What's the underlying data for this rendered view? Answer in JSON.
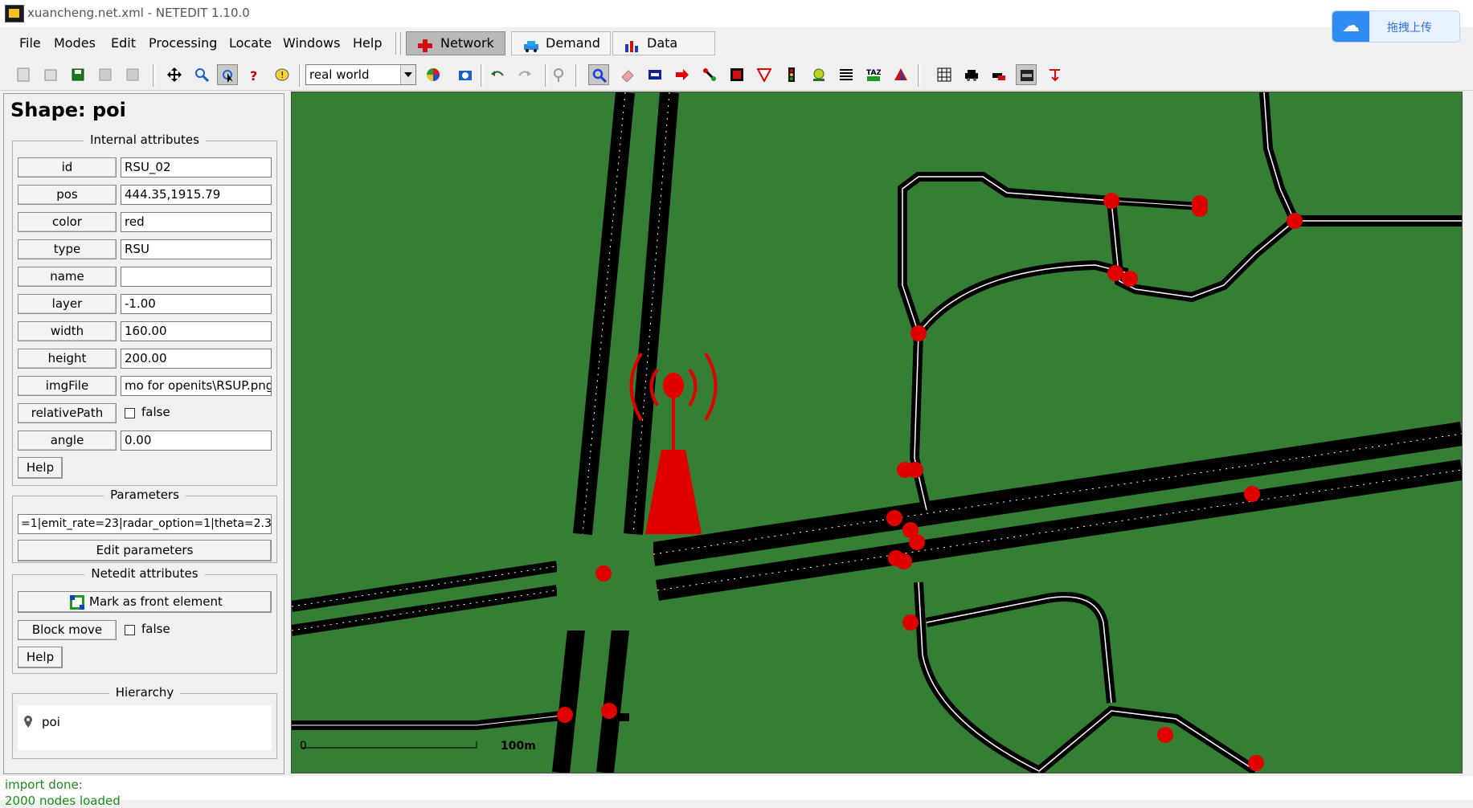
{
  "window": {
    "title": "xuancheng.net.xml - NETEDIT 1.10.0"
  },
  "upload_button": {
    "label": "拖拽上传"
  },
  "menu": {
    "items": [
      "File",
      "Modes",
      "Edit",
      "Processing",
      "Locate",
      "Windows",
      "Help"
    ],
    "supermodes": [
      "Network",
      "Demand",
      "Data"
    ],
    "active_supermode": "Network"
  },
  "toolbar": {
    "view_scheme": "real world"
  },
  "frame": {
    "title": "Shape: poi",
    "internal_caption": "Internal attributes",
    "attributes": [
      {
        "name": "id",
        "value": "RSU_02"
      },
      {
        "name": "pos",
        "value": "444.35,1915.79"
      },
      {
        "name": "color",
        "value": "red"
      },
      {
        "name": "type",
        "value": "RSU"
      },
      {
        "name": "name",
        "value": ""
      },
      {
        "name": "layer",
        "value": "-1.00"
      },
      {
        "name": "width",
        "value": "160.00"
      },
      {
        "name": "height",
        "value": "200.00"
      },
      {
        "name": "imgFile",
        "value": "mo for openits\\RSUP.png"
      },
      {
        "name": "relativePath",
        "value": "false"
      },
      {
        "name": "angle",
        "value": "0.00"
      }
    ],
    "help_label": "Help",
    "parameters_caption": "Parameters",
    "parameters_value": "=1|emit_rate=23|radar_option=1|theta=2.3",
    "edit_parameters_label": "Edit parameters",
    "netedit_caption": "Netedit attributes",
    "mark_front_label": "Mark as front element",
    "block_move_label": "Block move",
    "block_move_value": "false",
    "netedit_help_label": "Help",
    "hierarchy_caption": "Hierarchy",
    "hierarchy_item": "poi"
  },
  "map": {
    "background": "#347f34",
    "road_color": "#000000",
    "junction_color": "#ff0000",
    "rsu_color": "#e00000",
    "scale_zero": "0",
    "scale_label": "100m"
  },
  "status": {
    "line1": "import done:",
    "line2": "  2000 nodes loaded"
  }
}
